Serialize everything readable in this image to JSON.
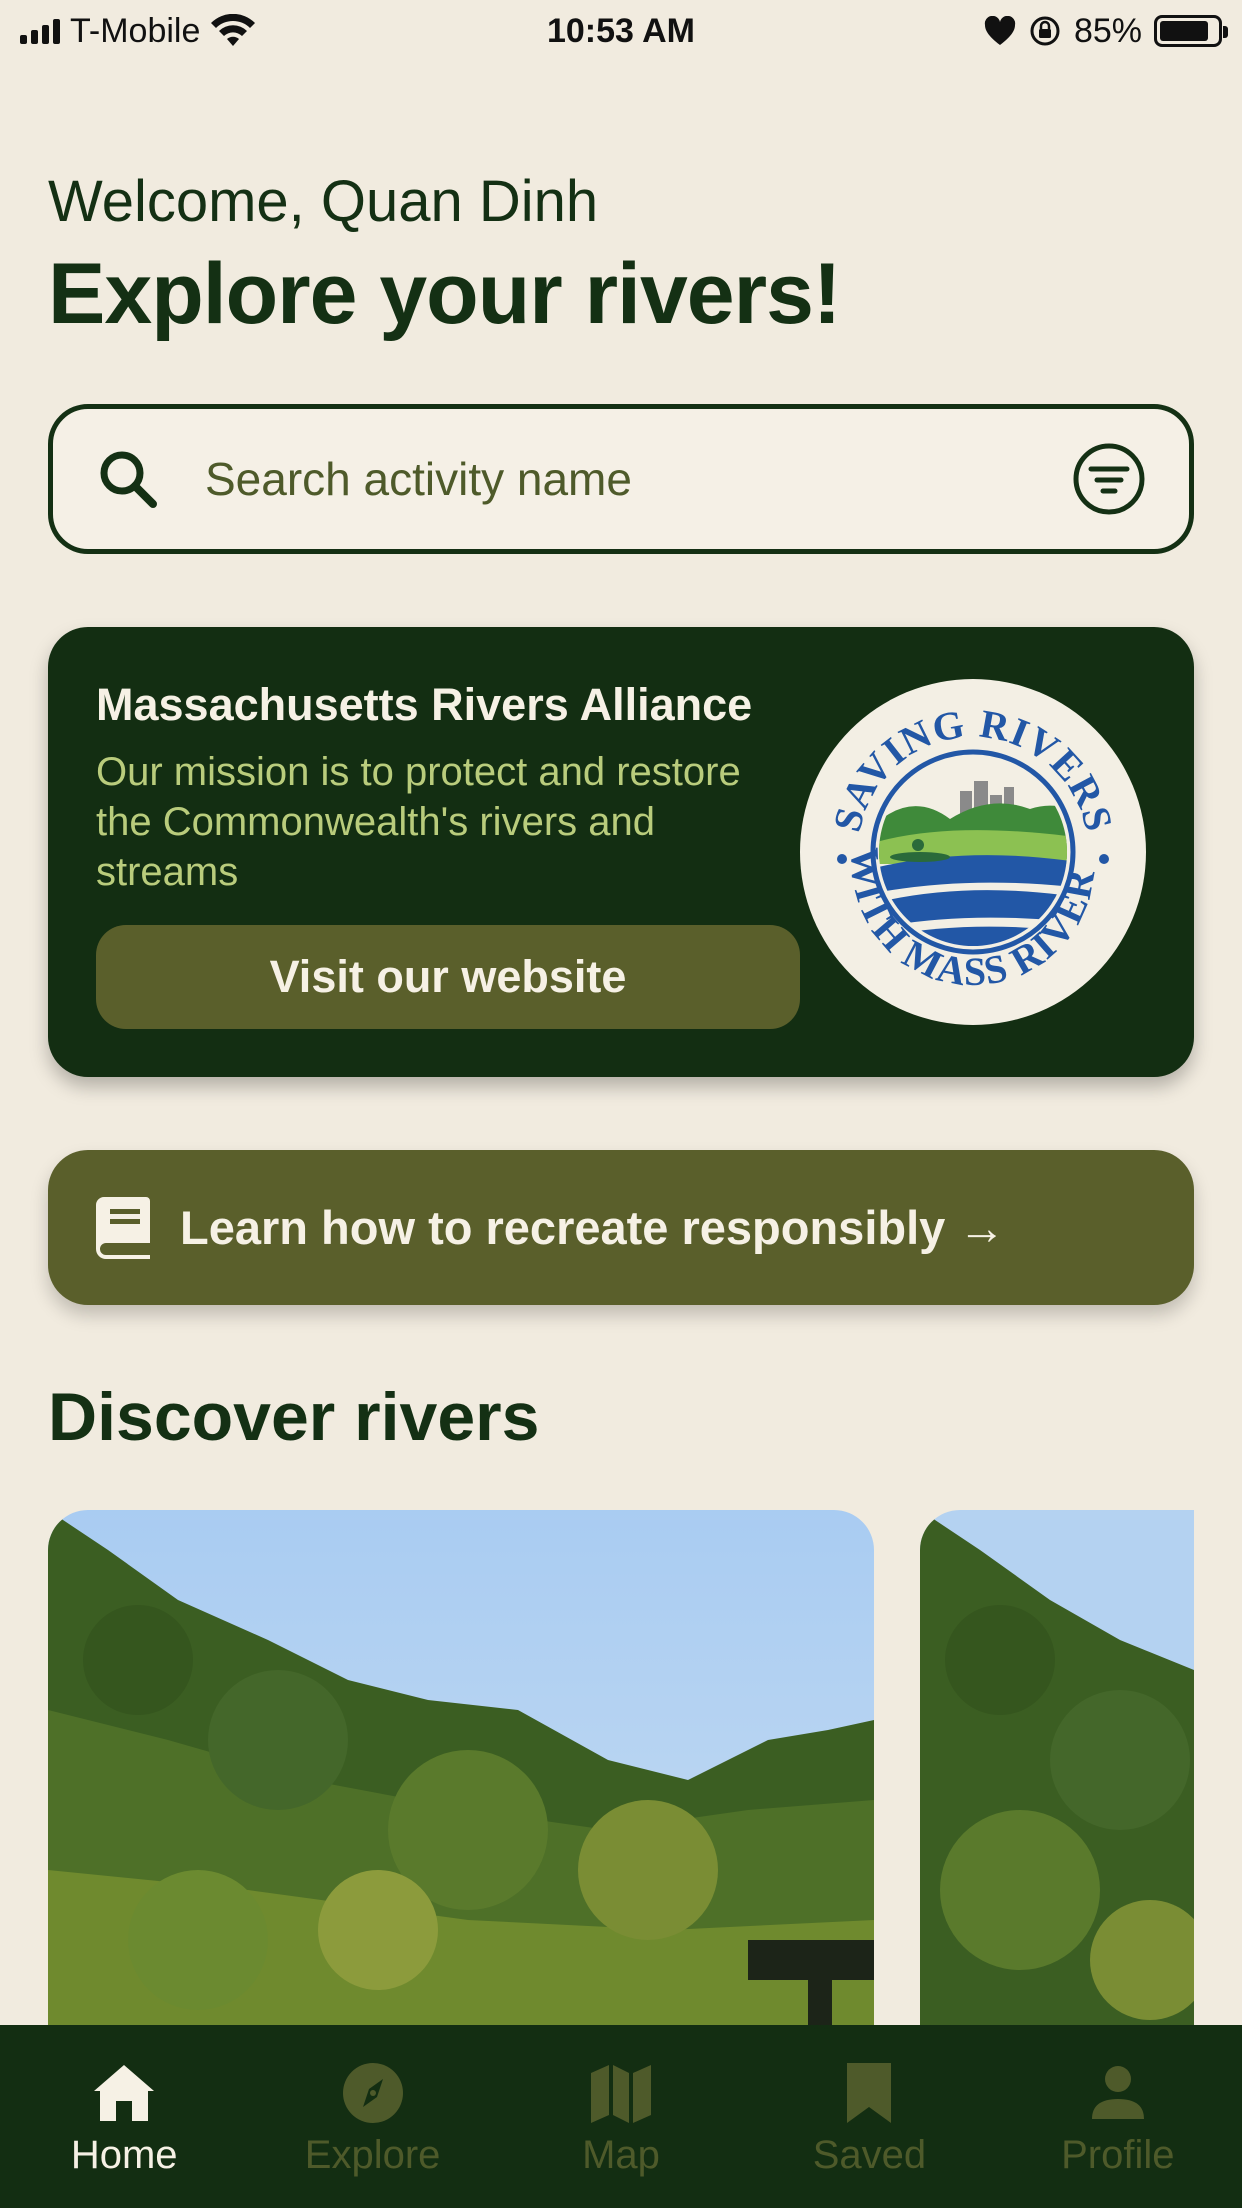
{
  "status_bar": {
    "carrier": "T-Mobile",
    "time": "10:53 AM",
    "battery": "85%",
    "battery_level": 0.85
  },
  "header": {
    "welcome": "Welcome, Quan Dinh",
    "headline": "Explore your rivers!"
  },
  "search": {
    "placeholder": "Search activity name",
    "icon": "search-icon",
    "filter_icon": "filter-icon"
  },
  "alliance": {
    "title": "Massachusetts Rivers Alliance",
    "description": "Our mission is to protect and restore the Commonwealth's rivers and streams",
    "button_label": "Visit our website",
    "logo_text_top": "SAVING RIVERS",
    "logo_text_bottom": "WITH MASS RIVERS"
  },
  "learn": {
    "label": "Learn how to recreate responsibly →",
    "icon": "book-icon"
  },
  "discover": {
    "title": "Discover rivers"
  },
  "tabs": [
    {
      "label": "Home",
      "icon": "home-icon",
      "active": true
    },
    {
      "label": "Explore",
      "icon": "compass-icon",
      "active": false
    },
    {
      "label": "Map",
      "icon": "map-icon",
      "active": false
    },
    {
      "label": "Saved",
      "icon": "bookmark-icon",
      "active": false
    },
    {
      "label": "Profile",
      "icon": "person-icon",
      "active": false
    }
  ],
  "colors": {
    "background": "#f1ebdf",
    "primary_dark": "#132e12",
    "olive": "#5a5f2b",
    "light_green_text": "#b9cc7c"
  }
}
